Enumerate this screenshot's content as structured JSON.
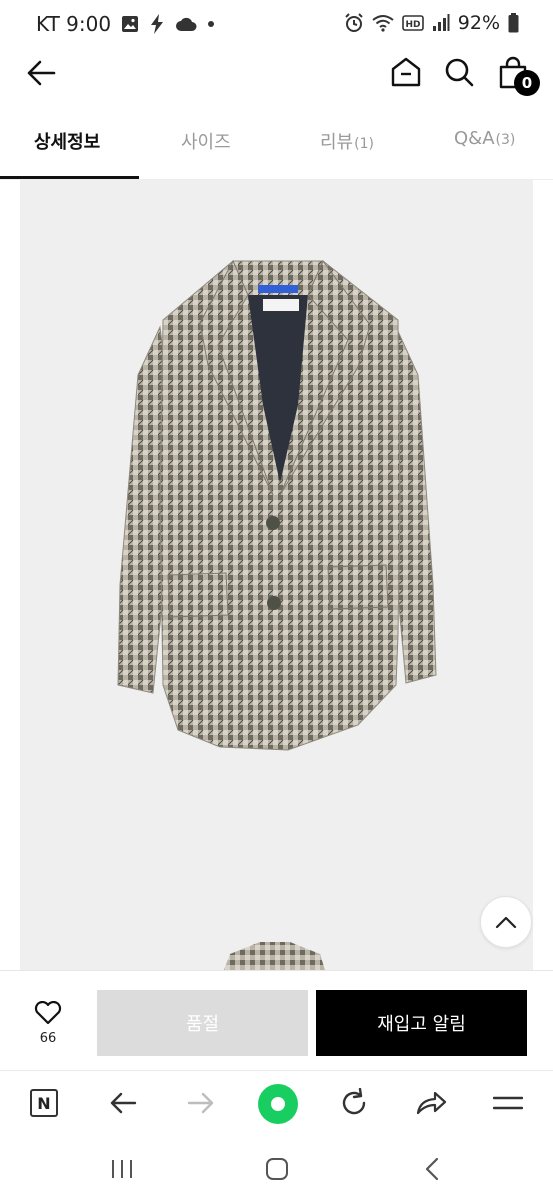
{
  "status_bar": {
    "carrier_time": "KT 9:00",
    "battery": "92%",
    "icons": [
      "image-icon",
      "bolt-icon",
      "cloud-icon",
      "dot-icon",
      "alarm-icon",
      "wifi-icon",
      "hd-icon",
      "signal-icon",
      "battery-icon"
    ]
  },
  "app_bar": {
    "cart_count": "0"
  },
  "tabs": [
    {
      "label": "상세정보",
      "count": ""
    },
    {
      "label": "사이즈",
      "count": ""
    },
    {
      "label": "리뷰",
      "count": "(1)"
    },
    {
      "label": "Q&A",
      "count": "(3)"
    }
  ],
  "actions": {
    "like_count": "66",
    "soldout_label": "품절",
    "restock_label": "재입고 알림"
  },
  "colors": {
    "accent_green": "#19ce60",
    "primary_button": "#000000",
    "disabled_button": "#dcdcdc"
  }
}
